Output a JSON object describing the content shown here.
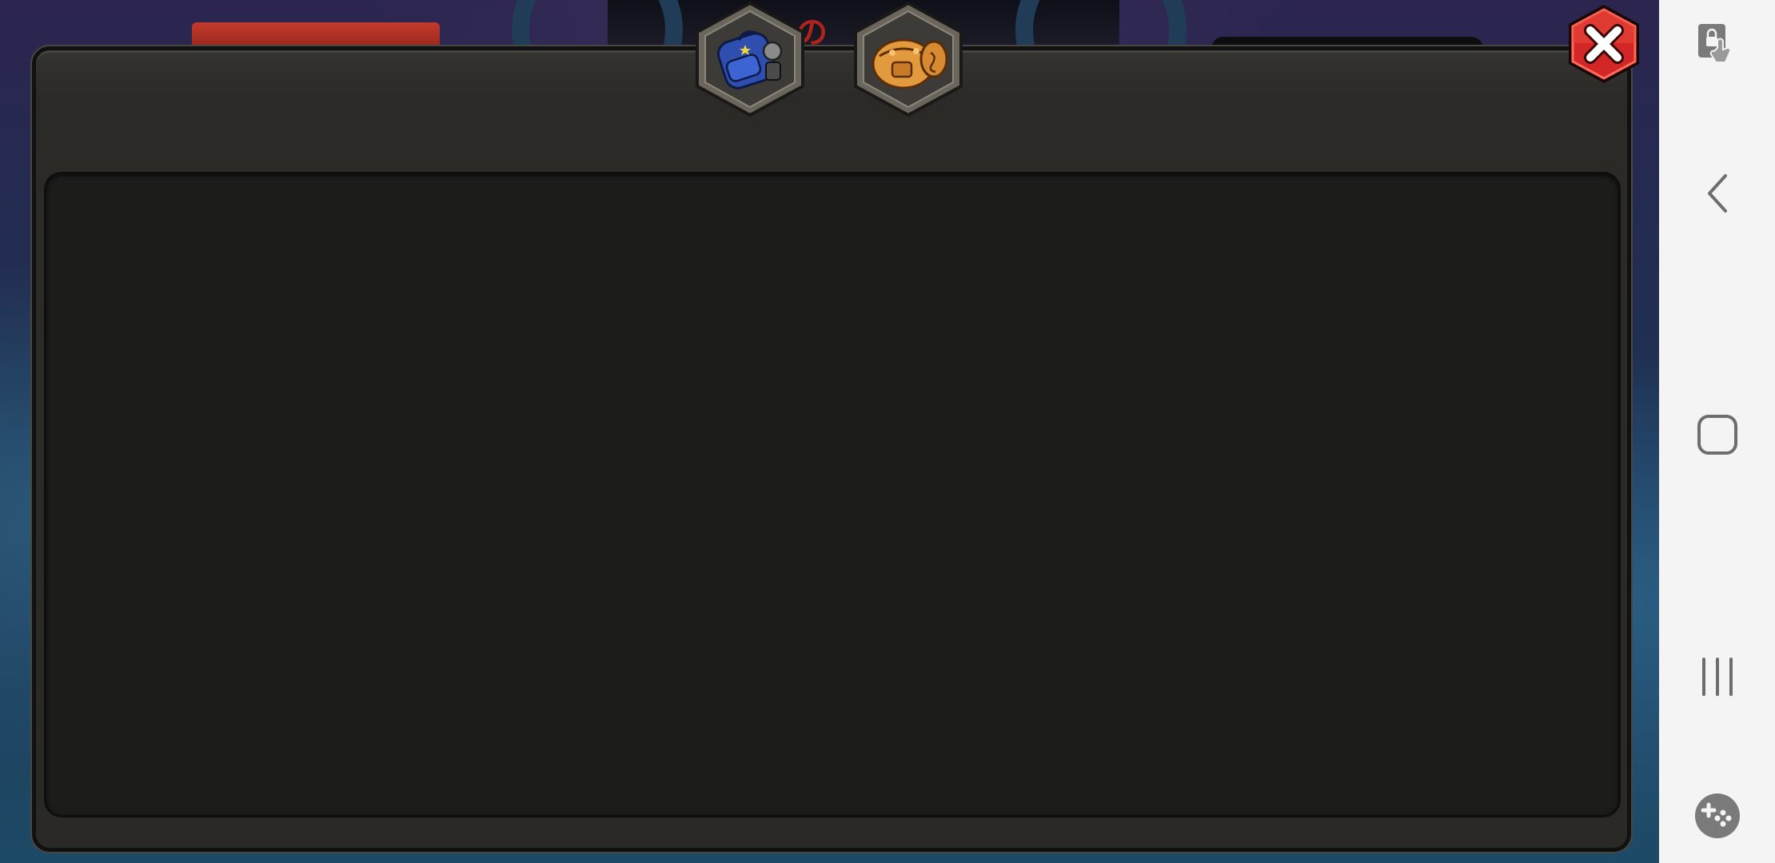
{
  "game": {
    "tabs": [
      {
        "id": "backpack",
        "icon": "blue-backpack-icon",
        "accent": "#2f4fb0"
      },
      {
        "id": "supply-bag",
        "icon": "orange-supply-bag-icon",
        "accent": "#e39a3d"
      }
    ],
    "close_icon": "close-icon",
    "colors": {
      "panel": "#2b2a27",
      "content": "#1c1c1b",
      "close_red": "#d32626"
    }
  },
  "nav_bar": {
    "items": [
      {
        "id": "touch-lock",
        "icon": "touch-lock-icon"
      },
      {
        "id": "back",
        "icon": "back-chevron-icon"
      },
      {
        "id": "home",
        "icon": "home-square-icon"
      },
      {
        "id": "recents",
        "icon": "recent-apps-icon"
      },
      {
        "id": "game-tools",
        "icon": "game-tools-icon"
      }
    ]
  }
}
